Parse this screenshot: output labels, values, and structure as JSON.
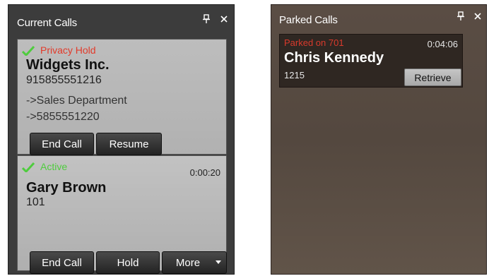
{
  "current_calls": {
    "title": "Current Calls",
    "calls": [
      {
        "status": "Privacy Hold",
        "name": "Widgets Inc.",
        "number": "915855551216",
        "details": [
          "->Sales Department",
          "->5855551220"
        ],
        "buttons": [
          "End Call",
          "Resume"
        ]
      },
      {
        "status": "Active",
        "timer": "0:00:20",
        "name": "Gary Brown",
        "number": "101",
        "buttons": [
          "End Call",
          "Hold",
          "More"
        ]
      }
    ]
  },
  "parked_calls": {
    "title": "Parked Calls",
    "call": {
      "status": "Parked on 701",
      "timer": "0:04:06",
      "name": "Chris Kennedy",
      "extension": "1215",
      "button": "Retrieve"
    }
  },
  "colors": {
    "status_hold": "#e23a2a",
    "status_active": "#4fcc3e",
    "status_parked": "#d93a2c"
  },
  "icons": {
    "pin": "pin-icon",
    "close": "close-icon",
    "status_check": "checkmark-icon",
    "more_dropdown": "chevron-down-icon"
  }
}
